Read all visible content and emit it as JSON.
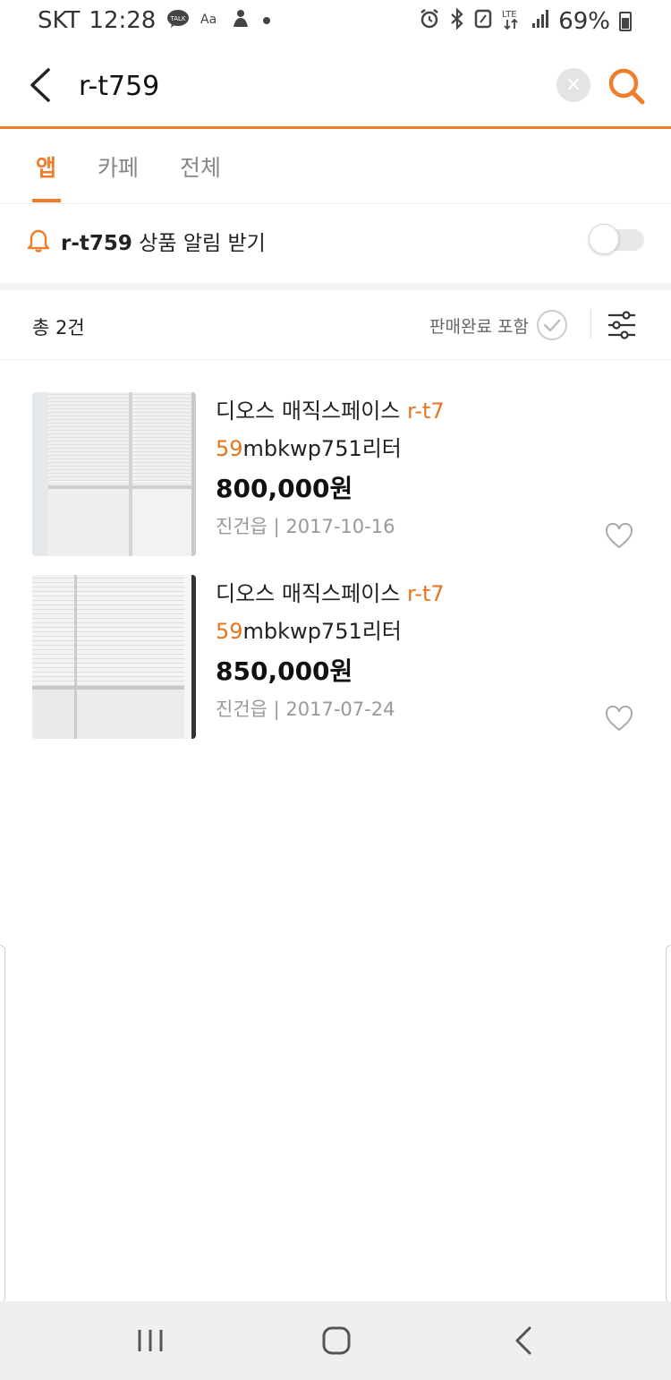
{
  "status_bar": {
    "carrier": "SKT",
    "time": "12:28",
    "left_icons": [
      "talk-icon",
      "font-icon",
      "silhouette-icon",
      "dot-icon"
    ],
    "right_icons": [
      "alarm-icon",
      "bluetooth-icon",
      "nfc-icon",
      "lte-icon",
      "signal-icon",
      "battery-icon"
    ],
    "battery": "69%",
    "network": "LTE"
  },
  "search": {
    "query": "r-t759",
    "clear_label": "×"
  },
  "tabs": [
    {
      "label": "앱",
      "active": true
    },
    {
      "label": "카페",
      "active": false
    },
    {
      "label": "전체",
      "active": false
    }
  ],
  "alert": {
    "keyword": "r-t759",
    "text": " 상품 알림 받기",
    "enabled": false
  },
  "results": {
    "total": "총 2건",
    "include_sold_label": "판매완료 포함"
  },
  "products": [
    {
      "title_prefix": "디오스 매직스페이스 ",
      "title_highlight": "r-t759",
      "title_suffix": "mbkwp751리터",
      "price": "800,000원",
      "location": "진건읍",
      "separator": " | ",
      "date": "2017-10-16"
    },
    {
      "title_prefix": "디오스 매직스페이스 ",
      "title_highlight": "r-t759",
      "title_suffix": "mbkwp751리터",
      "price": "850,000원",
      "location": "진건읍",
      "separator": " | ",
      "date": "2017-07-24"
    }
  ],
  "colors": {
    "accent": "#f07d2a",
    "highlight": "#e8741e",
    "nav_bg": "#efefef"
  }
}
